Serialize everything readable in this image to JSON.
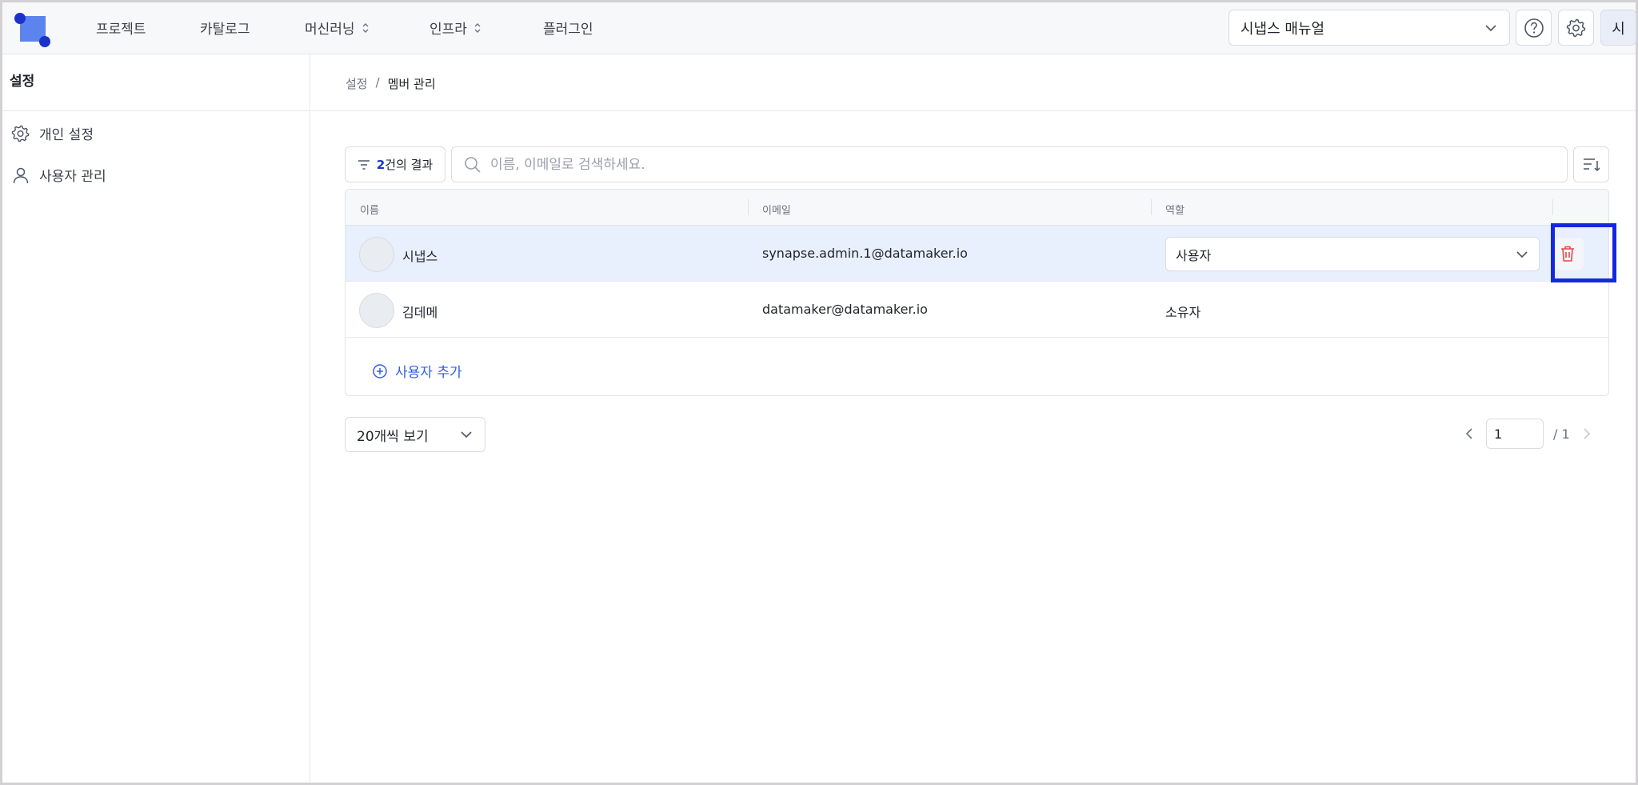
{
  "topnav": {
    "menu": [
      {
        "label": "프로젝트",
        "has_toggle": false
      },
      {
        "label": "카탈로그",
        "has_toggle": false
      },
      {
        "label": "머신러닝",
        "has_toggle": true
      },
      {
        "label": "인프라",
        "has_toggle": true
      },
      {
        "label": "플러그인",
        "has_toggle": false
      }
    ],
    "project_selector": "시냅스 매뉴얼",
    "avatar_initial": "시"
  },
  "sidebar": {
    "title": "설정",
    "items": [
      {
        "label": "개인 설정",
        "icon": "gear-icon"
      },
      {
        "label": "사용자 관리",
        "icon": "user-icon"
      }
    ]
  },
  "breadcrumb": {
    "root": "설정",
    "separator": "/",
    "current": "멤버 관리"
  },
  "toolbar": {
    "result_count": "2",
    "result_suffix": "건의 결과",
    "search_placeholder": "이름, 이메일로 검색하세요."
  },
  "table": {
    "headers": {
      "name": "이름",
      "email": "이메일",
      "role": "역할"
    },
    "rows": [
      {
        "name": "시냅스",
        "email": "synapse.admin.1@datamaker.io",
        "role": "사용자",
        "editable": true,
        "selected": true
      },
      {
        "name": "김데메",
        "email": "datamaker@datamaker.io",
        "role": "소유자",
        "editable": false,
        "selected": false
      }
    ],
    "add_user_label": "사용자 추가"
  },
  "pagination": {
    "per_page": "20개씩 보기",
    "current_page": "1",
    "total_pages": "/ 1"
  },
  "colors": {
    "accent": "#1c33c9",
    "link": "#2d5fe0",
    "selected_row": "#e8f0fd",
    "delete": "#e5484d",
    "highlight": "#1428e0"
  }
}
